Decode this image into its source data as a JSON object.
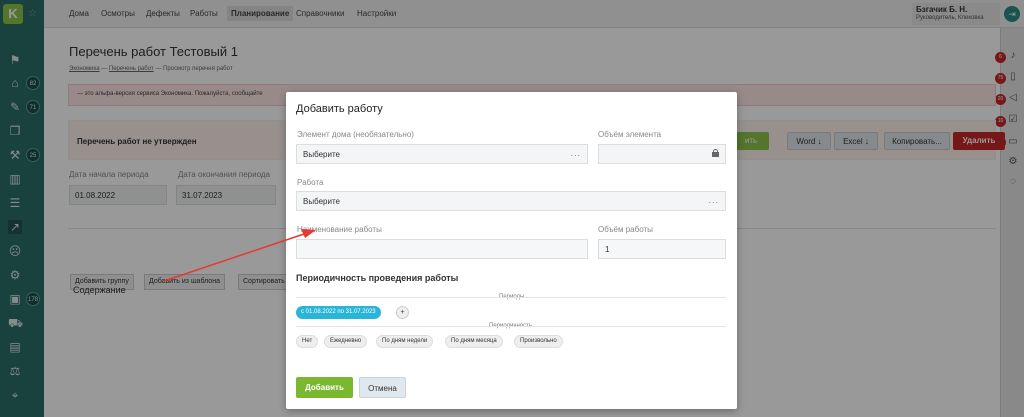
{
  "sidebar": {
    "logo": "K",
    "star": "☆",
    "badges": [
      "82",
      "71",
      "25",
      "178"
    ]
  },
  "topnav": {
    "items": [
      "Дома",
      "Осмотры",
      "Дефекты",
      "Работы",
      "Планирование",
      "Справочники",
      "Настройки"
    ],
    "active": "Планирование"
  },
  "user": {
    "name": "Бзгачик Б. Н.",
    "role": "Руководитель, Клековка"
  },
  "right_badges": [
    "6",
    "75",
    "20",
    "16",
    "30"
  ],
  "page": {
    "title": "Перечень работ Тестовый 1",
    "breadcrumb_1": "Экономика",
    "breadcrumb_2": "Перечень работ",
    "breadcrumb_3": "Просмотр перечня работ",
    "alert_text": "— это альфа-версия сервиса Экономика. Пожалуйста, сообщайте",
    "status_text": "Перечень работ не утвержден",
    "start_label": "Дата начала периода",
    "start_value": "01.08.2022",
    "end_label": "Дата окончания периода",
    "end_value": "31.07.2023",
    "approve_btn": "ить",
    "word_btn": "Word ↓",
    "excel_btn": "Excel ↓",
    "copy_btn": "Копировать...",
    "delete_btn": "Удалить",
    "add_group_btn": "Добавить группу",
    "add_template_btn": "Добавить из шаблона",
    "sort_btn": "Сортировать",
    "contents_label": "Содержание"
  },
  "modal": {
    "title": "Добавить работу",
    "element_label": "Элемент дома (необязательно)",
    "element_value": "Выберите",
    "volume_label": "Объём элемента",
    "work_label": "Работа",
    "work_value": "Выберите",
    "name_label": "Наименование работы",
    "work_volume_label": "Объём работы",
    "work_volume_value": "1",
    "periodicity_title": "Периодичность проведения работы",
    "periods_label": "Периоды",
    "period_chip": "с 01.08.2022 по 31.07.2023",
    "plus": "+",
    "frequency_label": "Периодичность",
    "frequency_options": [
      "Нет",
      "Ежедневно",
      "По дням недели",
      "По дням месяца",
      "Произвольно"
    ],
    "add_btn": "Добавить",
    "cancel_btn": "Отмена",
    "dots": "..."
  },
  "colors": {
    "sidebar": "#2a6f6a",
    "accent_green": "#8bc34a",
    "chip_blue": "#29b6d6",
    "delete_red": "#c62828",
    "annotation_red": "#e53935"
  }
}
